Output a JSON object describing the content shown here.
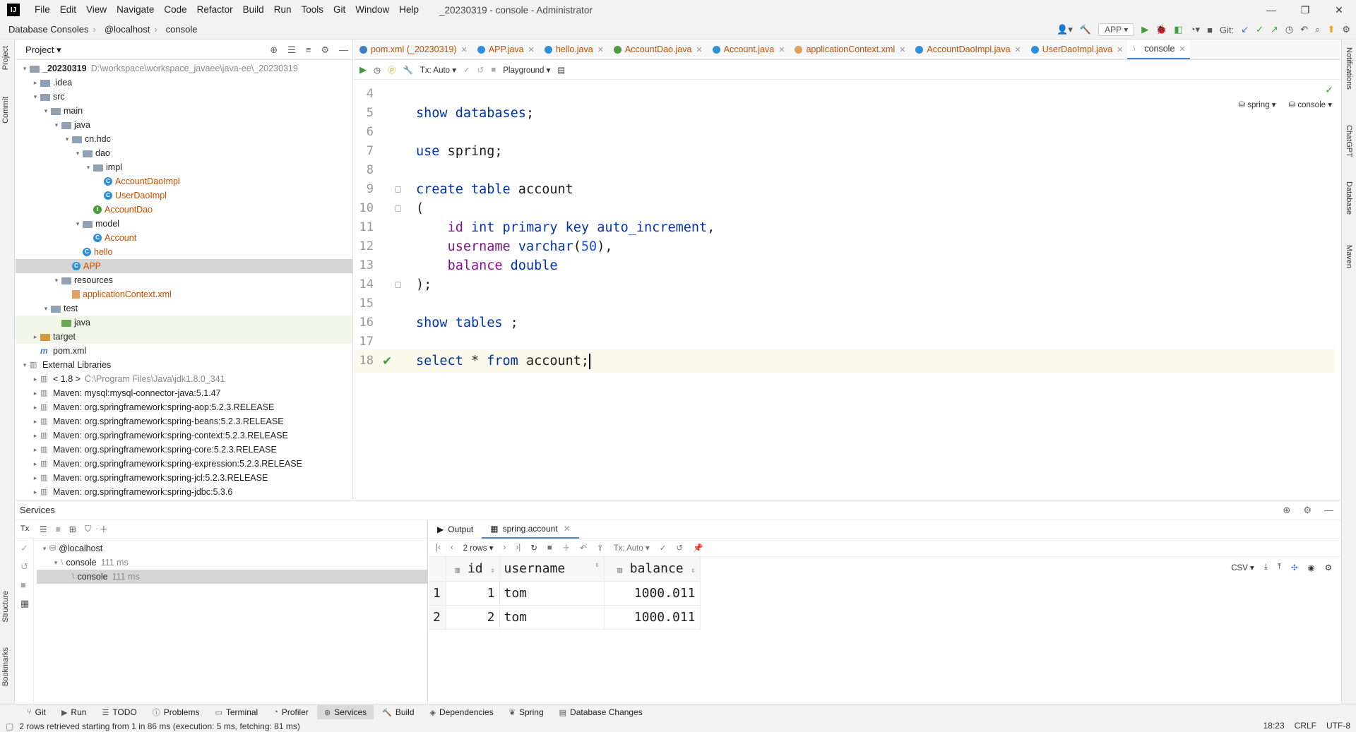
{
  "menubar": {
    "logo": "IJ",
    "items": [
      "File",
      "Edit",
      "View",
      "Navigate",
      "Code",
      "Refactor",
      "Build",
      "Run",
      "Tools",
      "Git",
      "Window",
      "Help"
    ],
    "window_title": "_20230319 - console - Administrator",
    "minimize": "—",
    "restore": "❐",
    "close": "✕"
  },
  "navbar": {
    "crumbs": [
      "Database Consoles",
      "@localhost",
      "console"
    ],
    "run_config": "APP",
    "git_label": "Git:"
  },
  "left_tool_tabs": [
    "Project",
    "Commit",
    "Structure",
    "Bookmarks"
  ],
  "right_tool_tabs": [
    "Notifications",
    "ChatGPT",
    "Database",
    "Maven"
  ],
  "project": {
    "title": "Project",
    "tree": [
      {
        "depth": 0,
        "arrow": "▾",
        "icon": "folder",
        "label": "_20230319",
        "extra": "D:\\workspace\\workspace_javaee\\java-ee\\_20230319",
        "bold": true
      },
      {
        "depth": 1,
        "arrow": "▸",
        "icon": "folder",
        "label": ".idea"
      },
      {
        "depth": 1,
        "arrow": "▾",
        "icon": "folder",
        "label": "src"
      },
      {
        "depth": 2,
        "arrow": "▾",
        "icon": "folder",
        "label": "main"
      },
      {
        "depth": 3,
        "arrow": "▾",
        "icon": "folder",
        "label": "java"
      },
      {
        "depth": 4,
        "arrow": "▾",
        "icon": "folder",
        "label": "cn.hdc"
      },
      {
        "depth": 5,
        "arrow": "▾",
        "icon": "folder",
        "label": "dao"
      },
      {
        "depth": 6,
        "arrow": "▾",
        "icon": "folder",
        "label": "impl"
      },
      {
        "depth": 7,
        "arrow": "",
        "icon": "class",
        "label": "AccountDaoImpl",
        "color": "orange"
      },
      {
        "depth": 7,
        "arrow": "",
        "icon": "class",
        "label": "UserDaoImpl",
        "color": "orange"
      },
      {
        "depth": 6,
        "arrow": "",
        "icon": "interface",
        "label": "AccountDao",
        "color": "orange"
      },
      {
        "depth": 5,
        "arrow": "▾",
        "icon": "folder",
        "label": "model"
      },
      {
        "depth": 6,
        "arrow": "",
        "icon": "class",
        "label": "Account",
        "color": "orange"
      },
      {
        "depth": 5,
        "arrow": "",
        "icon": "class",
        "label": "hello",
        "color": "orange"
      },
      {
        "depth": 4,
        "arrow": "",
        "icon": "class",
        "label": "APP",
        "color": "orange",
        "selected": true
      },
      {
        "depth": 3,
        "arrow": "▾",
        "icon": "folder",
        "label": "resources"
      },
      {
        "depth": 4,
        "arrow": "",
        "icon": "xml",
        "label": "applicationContext.xml",
        "color": "orange"
      },
      {
        "depth": 2,
        "arrow": "▾",
        "icon": "folder",
        "label": "test"
      },
      {
        "depth": 3,
        "arrow": "",
        "icon": "folder-green",
        "label": "java",
        "highlight": true
      },
      {
        "depth": 1,
        "arrow": "▸",
        "icon": "folder-orange",
        "label": "target",
        "highlight": true
      },
      {
        "depth": 1,
        "arrow": "",
        "icon": "maven",
        "label": "pom.xml"
      },
      {
        "depth": 0,
        "arrow": "▾",
        "icon": "lib",
        "label": "External Libraries"
      },
      {
        "depth": 1,
        "arrow": "▸",
        "icon": "lib",
        "label": "< 1.8 >",
        "extra": "C:\\Program Files\\Java\\jdk1.8.0_341"
      },
      {
        "depth": 1,
        "arrow": "▸",
        "icon": "lib",
        "label": "Maven: mysql:mysql-connector-java:5.1.47"
      },
      {
        "depth": 1,
        "arrow": "▸",
        "icon": "lib",
        "label": "Maven: org.springframework:spring-aop:5.2.3.RELEASE"
      },
      {
        "depth": 1,
        "arrow": "▸",
        "icon": "lib",
        "label": "Maven: org.springframework:spring-beans:5.2.3.RELEASE"
      },
      {
        "depth": 1,
        "arrow": "▸",
        "icon": "lib",
        "label": "Maven: org.springframework:spring-context:5.2.3.RELEASE"
      },
      {
        "depth": 1,
        "arrow": "▸",
        "icon": "lib",
        "label": "Maven: org.springframework:spring-core:5.2.3.RELEASE"
      },
      {
        "depth": 1,
        "arrow": "▸",
        "icon": "lib",
        "label": "Maven: org.springframework:spring-expression:5.2.3.RELEASE"
      },
      {
        "depth": 1,
        "arrow": "▸",
        "icon": "lib",
        "label": "Maven: org.springframework:spring-jcl:5.2.3.RELEASE"
      },
      {
        "depth": 1,
        "arrow": "▸",
        "icon": "lib",
        "label": "Maven: org.springframework:spring-jdbc:5.3.6"
      }
    ]
  },
  "editor": {
    "tabs": [
      {
        "label": "pom.xml (_20230319)",
        "icon": "maven"
      },
      {
        "label": "APP.java",
        "icon": "class"
      },
      {
        "label": "hello.java",
        "icon": "class"
      },
      {
        "label": "AccountDao.java",
        "icon": "interface"
      },
      {
        "label": "Account.java",
        "icon": "class"
      },
      {
        "label": "applicationContext.xml",
        "icon": "xml"
      },
      {
        "label": "AccountDaoImpl.java",
        "icon": "class"
      },
      {
        "label": "UserDaoImpl.java",
        "icon": "class"
      },
      {
        "label": "console",
        "icon": "console",
        "active": true
      }
    ],
    "toolbar": {
      "tx": "Tx: Auto",
      "playground": "Playground",
      "schema": "spring",
      "session": "console"
    },
    "lines": [
      {
        "n": "4",
        "html": ""
      },
      {
        "n": "5",
        "html": "<span class=\"kw\">show</span> <span class=\"kw\">databases</span>;"
      },
      {
        "n": "6",
        "html": ""
      },
      {
        "n": "7",
        "html": "<span class=\"kw\">use</span> spring;"
      },
      {
        "n": "8",
        "html": ""
      },
      {
        "n": "9",
        "html": "<span class=\"kw\">create</span> <span class=\"kw\">table</span> account"
      },
      {
        "n": "10",
        "html": "("
      },
      {
        "n": "11",
        "html": "    <span class=\"fld\">id</span> <span class=\"kw\">int</span> <span class=\"kw\">primary key</span> <span class=\"kw\">auto_increment</span>,"
      },
      {
        "n": "12",
        "html": "    <span class=\"fld\">username</span> <span class=\"kw\">varchar</span>(<span class=\"num\">50</span>),"
      },
      {
        "n": "13",
        "html": "    <span class=\"fld\">balance</span> <span class=\"kw\">double</span>"
      },
      {
        "n": "14",
        "html": ");"
      },
      {
        "n": "15",
        "html": ""
      },
      {
        "n": "16",
        "html": "<span class=\"kw\">show</span> <span class=\"kw\">tables</span> ;"
      },
      {
        "n": "17",
        "html": ""
      },
      {
        "n": "18",
        "html": "<span class=\"kw\">select</span> * <span class=\"kw\">from</span> account;"
      }
    ]
  },
  "services": {
    "title": "Services",
    "tree": [
      {
        "depth": 0,
        "arrow": "▾",
        "label": "@localhost"
      },
      {
        "depth": 1,
        "arrow": "▾",
        "label": "console",
        "time": "111 ms"
      },
      {
        "depth": 2,
        "arrow": "",
        "label": "console",
        "time": "111 ms",
        "selected": true
      }
    ],
    "result_tabs": [
      "Output",
      "spring.account"
    ],
    "rows_label": "2 rows",
    "tx": "Tx: Auto",
    "export": "CSV",
    "columns": [
      "id",
      "username",
      "balance"
    ],
    "rows": [
      {
        "idx": "1",
        "id": "1",
        "username": "tom",
        "balance": "1000.011"
      },
      {
        "idx": "2",
        "id": "2",
        "username": "tom",
        "balance": "1000.011"
      }
    ]
  },
  "toolwindows": [
    "Git",
    "Run",
    "TODO",
    "Problems",
    "Terminal",
    "Profiler",
    "Services",
    "Build",
    "Dependencies",
    "Spring",
    "Database Changes"
  ],
  "status": {
    "message": "2 rows retrieved starting from 1 in 86 ms (execution: 5 ms, fetching: 81 ms)",
    "position": "18:23",
    "line_sep": "CRLF",
    "encoding": "UTF-8"
  }
}
